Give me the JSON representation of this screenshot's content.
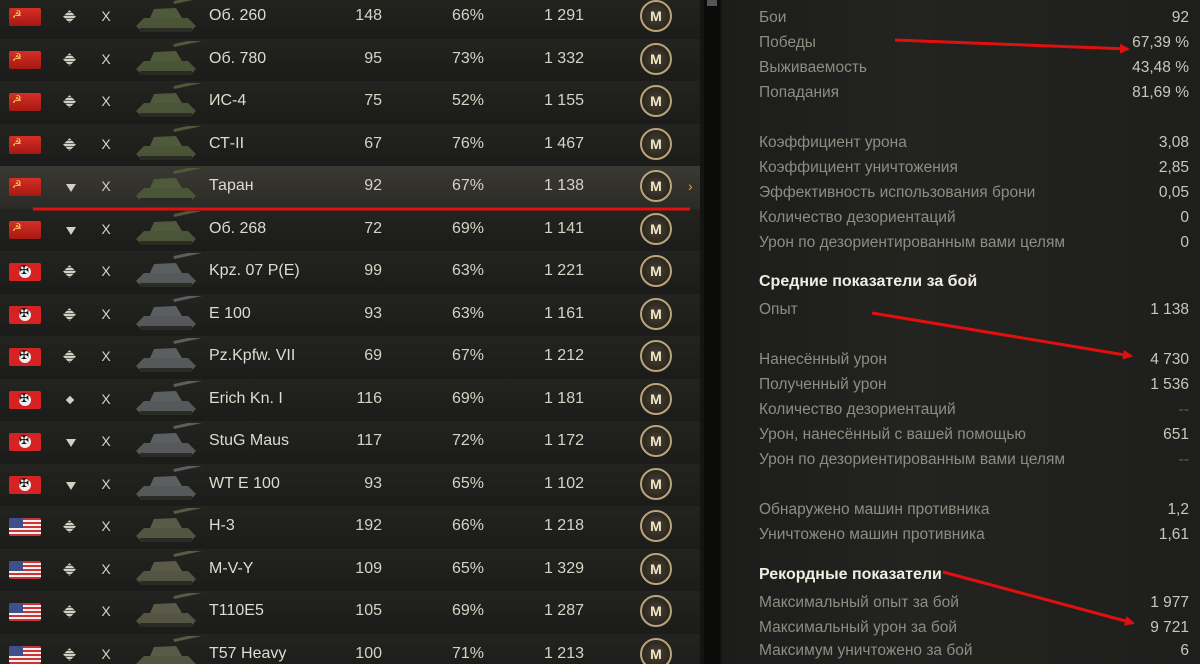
{
  "vehicles": [
    {
      "nation": "ussr",
      "type": "diamond",
      "tier": "X",
      "name": "Об. 260",
      "battles": "148",
      "winrate": "66%",
      "exp": "1 291",
      "badge": "M"
    },
    {
      "nation": "ussr",
      "type": "diamond",
      "tier": "X",
      "name": "Об. 780",
      "battles": "95",
      "winrate": "73%",
      "exp": "1 332",
      "badge": "M"
    },
    {
      "nation": "ussr",
      "type": "diamond",
      "tier": "X",
      "name": "ИС-4",
      "battles": "75",
      "winrate": "52%",
      "exp": "1 155",
      "badge": "M"
    },
    {
      "nation": "ussr",
      "type": "diamond",
      "tier": "X",
      "name": "СТ-II",
      "battles": "67",
      "winrate": "76%",
      "exp": "1 467",
      "badge": "M"
    },
    {
      "nation": "ussr",
      "type": "tri",
      "tier": "X",
      "name": "Таран",
      "battles": "92",
      "winrate": "67%",
      "exp": "1 138",
      "badge": "M",
      "selected": true
    },
    {
      "nation": "ussr",
      "type": "tri",
      "tier": "X",
      "name": "Об. 268",
      "battles": "72",
      "winrate": "69%",
      "exp": "1 141",
      "badge": "M"
    },
    {
      "nation": "germany",
      "type": "diamond",
      "tier": "X",
      "name": "Kpz. 07 P(E)",
      "battles": "99",
      "winrate": "63%",
      "exp": "1 221",
      "badge": "M"
    },
    {
      "nation": "germany",
      "type": "diamond",
      "tier": "X",
      "name": "E 100",
      "battles": "93",
      "winrate": "63%",
      "exp": "1 161",
      "badge": "M"
    },
    {
      "nation": "germany",
      "type": "diamond",
      "tier": "X",
      "name": "Pz.Kpfw. VII",
      "battles": "69",
      "winrate": "67%",
      "exp": "1 212",
      "badge": "M"
    },
    {
      "nation": "germany",
      "type": "small",
      "tier": "X",
      "name": "Erich Kn. I",
      "battles": "116",
      "winrate": "69%",
      "exp": "1 181",
      "badge": "M"
    },
    {
      "nation": "germany",
      "type": "tri",
      "tier": "X",
      "name": "StuG Maus",
      "battles": "117",
      "winrate": "72%",
      "exp": "1 172",
      "badge": "M"
    },
    {
      "nation": "germany",
      "type": "tri",
      "tier": "X",
      "name": "WT E 100",
      "battles": "93",
      "winrate": "65%",
      "exp": "1 102",
      "badge": "M"
    },
    {
      "nation": "usa",
      "type": "diamond",
      "tier": "X",
      "name": "H-3",
      "battles": "192",
      "winrate": "66%",
      "exp": "1 218",
      "badge": "M"
    },
    {
      "nation": "usa",
      "type": "diamond",
      "tier": "X",
      "name": "M-V-Y",
      "battles": "109",
      "winrate": "65%",
      "exp": "1 329",
      "badge": "M"
    },
    {
      "nation": "usa",
      "type": "diamond",
      "tier": "X",
      "name": "T110E5",
      "battles": "105",
      "winrate": "69%",
      "exp": "1 287",
      "badge": "M"
    },
    {
      "nation": "usa",
      "type": "diamond",
      "tier": "X",
      "name": "T57 Heavy",
      "battles": "100",
      "winrate": "71%",
      "exp": "1 213",
      "badge": "M"
    }
  ],
  "selected_arrow": "›",
  "stats": {
    "general": [
      {
        "label": "Бои",
        "value": "92"
      },
      {
        "label": "Победы",
        "value": "67,39 %"
      },
      {
        "label": "Выживаемость",
        "value": "43,48 %"
      },
      {
        "label": "Попадания",
        "value": "81,69 %"
      }
    ],
    "ratios": [
      {
        "label": "Коэффициент урона",
        "value": "3,08"
      },
      {
        "label": "Коэффициент уничтожения",
        "value": "2,85"
      },
      {
        "label": "Эффективность использования брони",
        "value": "0,05"
      },
      {
        "label": "Количество дезориентаций",
        "value": "0"
      },
      {
        "label": "Урон по дезориентированным вами целям",
        "value": "0"
      }
    ],
    "avg_title": "Средние показатели за бой",
    "avg": [
      {
        "label": "Опыт",
        "value": "1 138"
      },
      {
        "label": "Нанесённый урон",
        "value": "4 730"
      },
      {
        "label": "Полученный урон",
        "value": "1 536"
      },
      {
        "label": "Количество дезориентаций",
        "value": "--"
      },
      {
        "label": "Урон, нанесённый с вашей помощью",
        "value": "651"
      },
      {
        "label": "Урон по дезориентированным вами целям",
        "value": "--"
      }
    ],
    "spotting": [
      {
        "label": "Обнаружено машин противника",
        "value": "1,2"
      },
      {
        "label": "Уничтожено машин противника",
        "value": "1,61"
      }
    ],
    "record_title": "Рекордные показатели",
    "record": [
      {
        "label": "Максимальный опыт за бой",
        "value": "1 977"
      },
      {
        "label": "Максимальный урон за бой",
        "value": "9 721"
      },
      {
        "label": "Максимум уничтожено за бой",
        "value": "6"
      }
    ]
  },
  "colors": {
    "annotation": "#e01010",
    "accent": "#e9a623"
  }
}
